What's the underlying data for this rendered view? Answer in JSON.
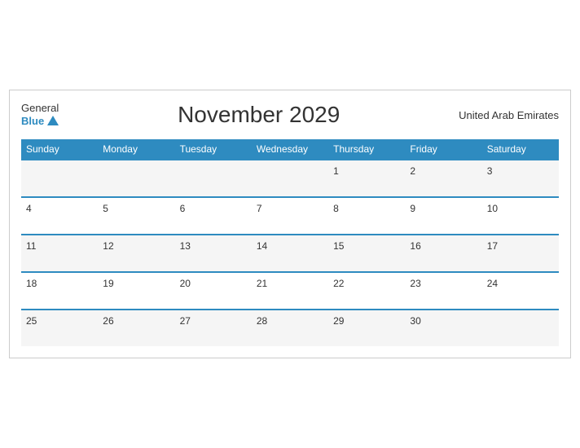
{
  "header": {
    "logo_general": "General",
    "logo_blue": "Blue",
    "title": "November 2029",
    "country": "United Arab Emirates"
  },
  "days": [
    "Sunday",
    "Monday",
    "Tuesday",
    "Wednesday",
    "Thursday",
    "Friday",
    "Saturday"
  ],
  "weeks": [
    [
      "",
      "",
      "",
      "",
      "1",
      "2",
      "3"
    ],
    [
      "4",
      "5",
      "6",
      "7",
      "8",
      "9",
      "10"
    ],
    [
      "11",
      "12",
      "13",
      "14",
      "15",
      "16",
      "17"
    ],
    [
      "18",
      "19",
      "20",
      "21",
      "22",
      "23",
      "24"
    ],
    [
      "25",
      "26",
      "27",
      "28",
      "29",
      "30",
      ""
    ]
  ]
}
